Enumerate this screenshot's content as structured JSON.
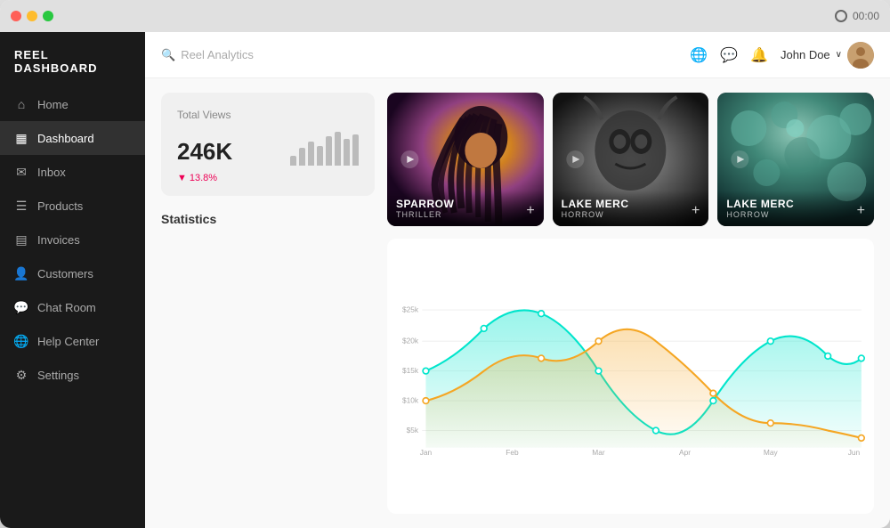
{
  "window": {
    "title": "Reel Dashboard",
    "timer": "00:00"
  },
  "sidebar": {
    "logo": "REEL DASHBOARD",
    "items": [
      {
        "id": "home",
        "label": "Home",
        "icon": "⌂",
        "active": false
      },
      {
        "id": "dashboard",
        "label": "Dashboard",
        "icon": "▦",
        "active": true
      },
      {
        "id": "inbox",
        "label": "Inbox",
        "icon": "✉",
        "active": false
      },
      {
        "id": "products",
        "label": "Products",
        "icon": "☰",
        "active": false
      },
      {
        "id": "invoices",
        "label": "Invoices",
        "icon": "📄",
        "active": false
      },
      {
        "id": "customers",
        "label": "Customers",
        "icon": "👤",
        "active": false
      },
      {
        "id": "chatroom",
        "label": "Chat Room",
        "icon": "💬",
        "active": false
      },
      {
        "id": "helpcenter",
        "label": "Help Center",
        "icon": "🌐",
        "active": false
      },
      {
        "id": "settings",
        "label": "Settings",
        "icon": "⚙",
        "active": false
      }
    ]
  },
  "topbar": {
    "search_placeholder": "Reel Analytics",
    "user_name": "John Doe",
    "chevron": "∨"
  },
  "stats": {
    "label": "Total Views",
    "value": "246K",
    "change": "13.8%",
    "change_direction": "down",
    "bars": [
      10,
      18,
      25,
      20,
      30,
      35,
      28,
      32
    ]
  },
  "section": {
    "statistics_label": "Statistics"
  },
  "movies": [
    {
      "id": "sparrow",
      "title": "SPARROW",
      "genre": "THRILLER",
      "card_type": "sparrow"
    },
    {
      "id": "lakemerc1",
      "title": "LAKE MERC",
      "genre": "HORROW",
      "card_type": "lakemerc1"
    },
    {
      "id": "lakemerc2",
      "title": "LAKE MERC",
      "genre": "HORROW",
      "card_type": "lakemerc2"
    }
  ],
  "chart": {
    "x_labels": [
      "Jan",
      "Feb",
      "Mar",
      "Apr",
      "May",
      "Jun"
    ],
    "y_labels": [
      "$25k",
      "$20k",
      "$15k",
      "$10k",
      "$5k"
    ],
    "colors": {
      "teal": "#00e5cc",
      "orange": "#f5a623",
      "line_teal": "#00d4bb",
      "line_orange": "#f0a030"
    }
  }
}
